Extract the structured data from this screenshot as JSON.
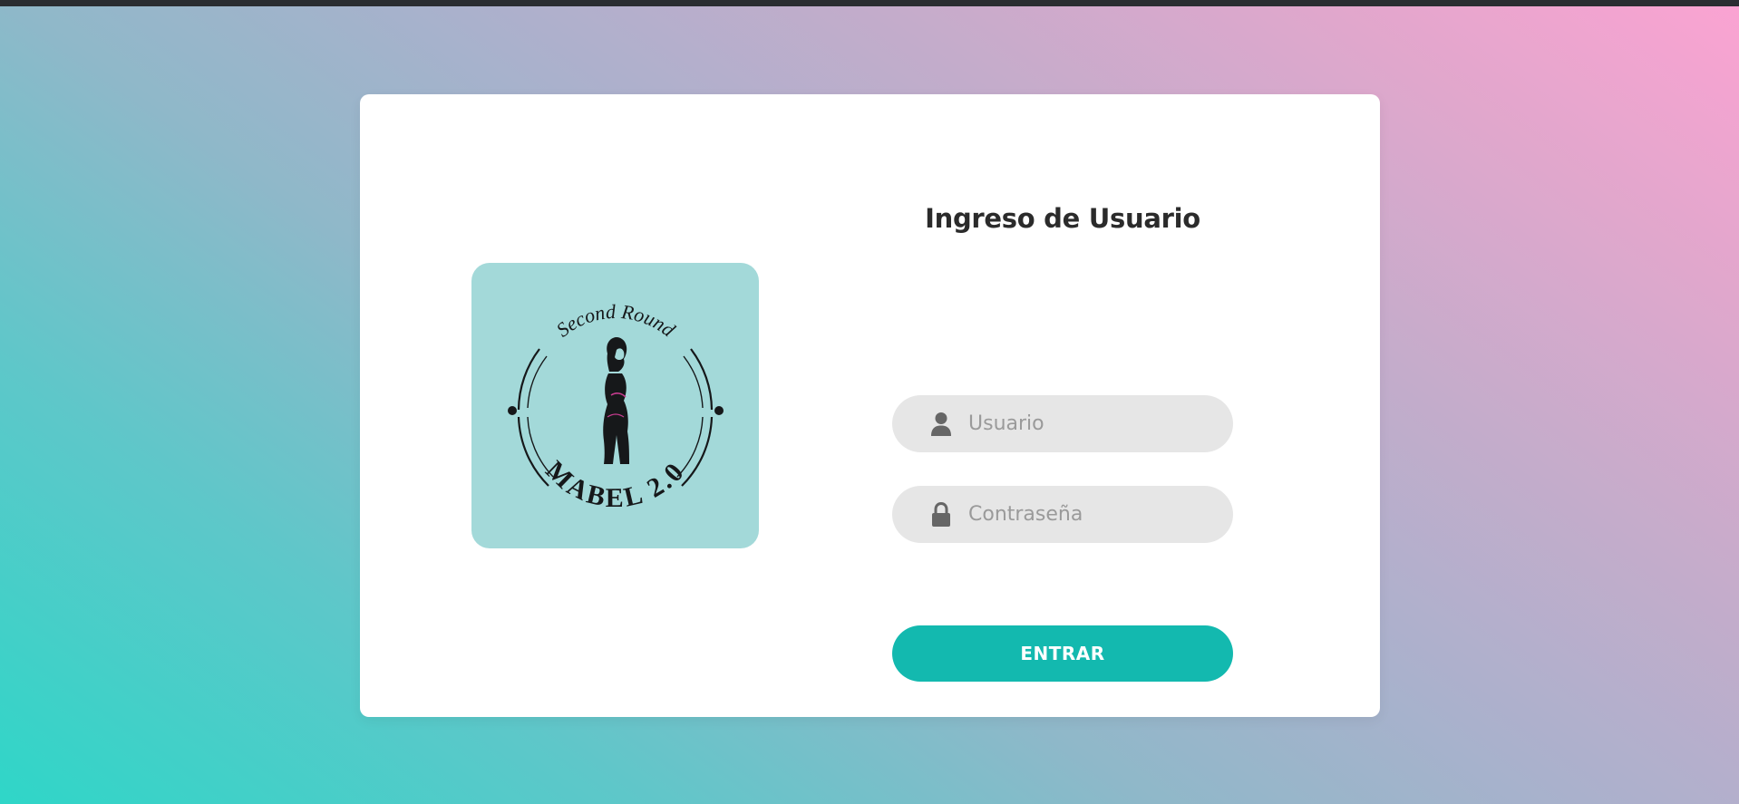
{
  "logo": {
    "top_text": "Second Round",
    "bottom_text": "MABEL 2.0",
    "background_color": "#a3d9d9"
  },
  "login": {
    "title": "Ingreso de Usuario",
    "username": {
      "placeholder": "Usuario",
      "value": "",
      "icon": "user-icon"
    },
    "password": {
      "placeholder": "Contraseña",
      "value": "",
      "icon": "lock-icon"
    },
    "submit_label": "ENTRAR"
  },
  "colors": {
    "accent": "#13b9af",
    "input_background": "#e6e6e6",
    "gradient_start": "#2fd6c8",
    "gradient_end": "#fba3d2"
  }
}
